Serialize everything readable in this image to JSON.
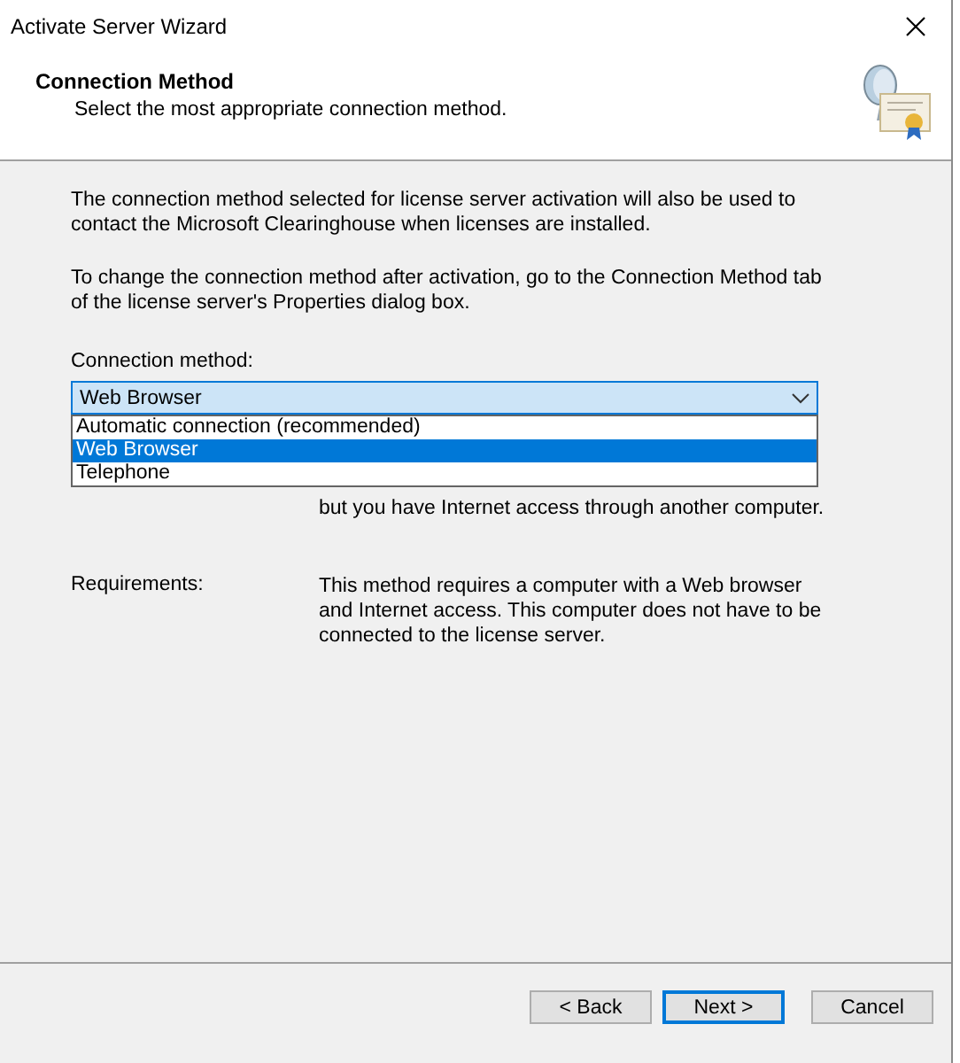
{
  "window": {
    "title": "Activate Server Wizard"
  },
  "header": {
    "title": "Connection Method",
    "subtitle": "Select the most appropriate connection method."
  },
  "paragraphs": [
    "The connection method selected for license server activation will also be used to contact the Microsoft Clearinghouse when licenses are installed.",
    "To change the connection method after activation, go to the Connection Method tab of the license server's Properties dialog box."
  ],
  "connection_method": {
    "label": "Connection method:",
    "value": "Web Browser",
    "expanded": true,
    "options": [
      {
        "label": "Automatic connection (recommended)",
        "selected": false
      },
      {
        "label": "Web Browser",
        "selected": true
      },
      {
        "label": "Telephone",
        "selected": false
      }
    ]
  },
  "description": "but you have Internet access through another computer.",
  "requirements": {
    "label": "Requirements:",
    "text": "This method requires a computer with a Web browser and Internet access. This computer does not have to be connected to the license server."
  },
  "buttons": [
    {
      "label": "< Back",
      "default": false
    },
    {
      "label": "Next >",
      "default": true
    },
    {
      "label": "Cancel",
      "default": false
    }
  ]
}
